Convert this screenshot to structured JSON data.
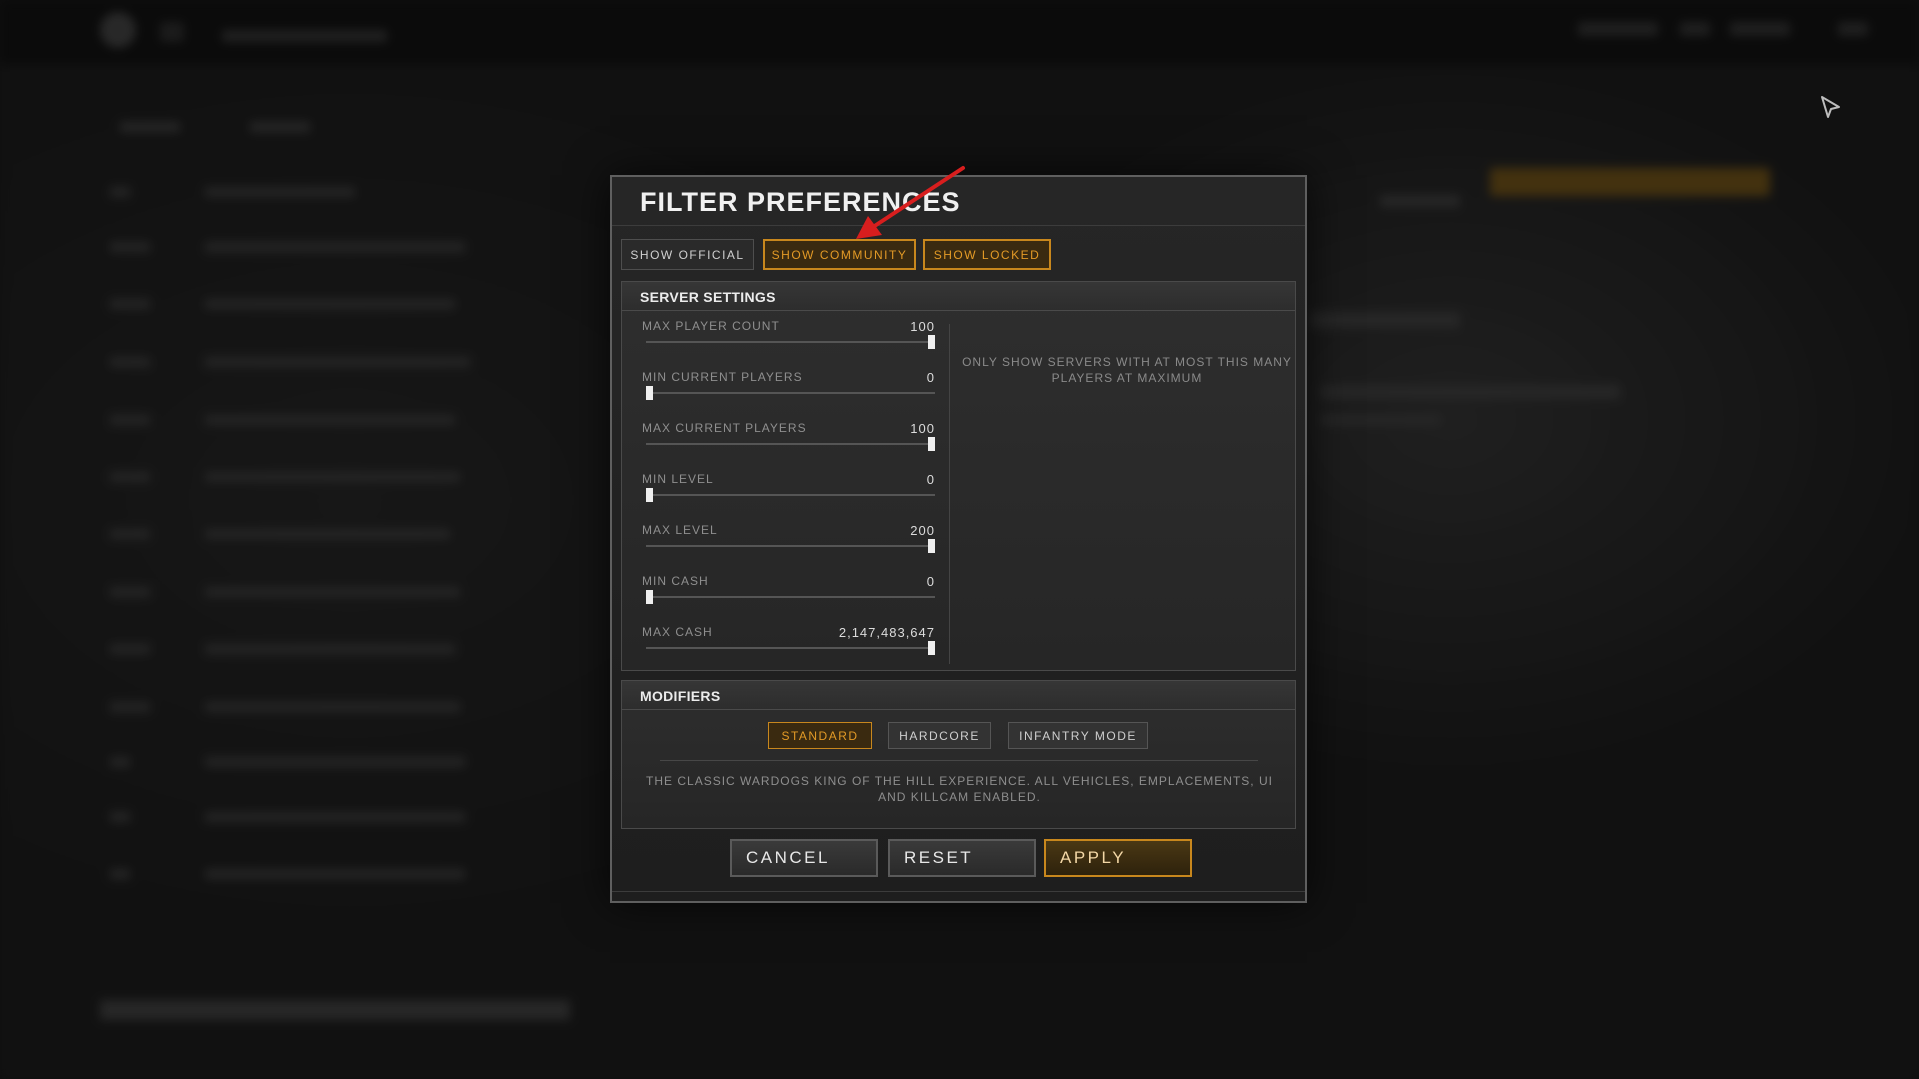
{
  "dialog": {
    "title": "FILTER PREFERENCES",
    "tabs": [
      {
        "label": "SHOW OFFICIAL",
        "active": false
      },
      {
        "label": "SHOW COMMUNITY",
        "active": true
      },
      {
        "label": "SHOW LOCKED",
        "active": true
      }
    ],
    "server_settings": {
      "heading": "SERVER SETTINGS",
      "sliders": [
        {
          "label": "MAX PLAYER COUNT",
          "value": "100",
          "fraction": 1
        },
        {
          "label": "MIN CURRENT PLAYERS",
          "value": "0",
          "fraction": 0
        },
        {
          "label": "MAX CURRENT PLAYERS",
          "value": "100",
          "fraction": 1
        },
        {
          "label": "MIN LEVEL",
          "value": "0",
          "fraction": 0
        },
        {
          "label": "MAX LEVEL",
          "value": "200",
          "fraction": 1
        },
        {
          "label": "MIN CASH",
          "value": "0",
          "fraction": 0
        },
        {
          "label": "MAX CASH",
          "value": "2,147,483,647",
          "fraction": 1
        }
      ],
      "hint": "ONLY SHOW SERVERS WITH AT MOST THIS MANY PLAYERS AT MAXIMUM"
    },
    "modifiers": {
      "heading": "MODIFIERS",
      "options": [
        {
          "label": "STANDARD",
          "active": true
        },
        {
          "label": "HARDCORE",
          "active": false
        },
        {
          "label": "INFANTRY MODE",
          "active": false
        }
      ],
      "description": "THE CLASSIC WARDOGS KING OF THE HILL EXPERIENCE. ALL VEHICLES, EMPLACEMENTS, UI AND KILLCAM ENABLED."
    },
    "actions": {
      "cancel": "CANCEL",
      "reset": "RESET",
      "apply": "APPLY"
    }
  },
  "colors": {
    "accent": "#c8871d",
    "accent_text": "#e39a26",
    "annotation_arrow": "#d81e1e"
  },
  "icons": {
    "annotation": "red-arrow-icon",
    "cursor": "mouse-cursor-icon"
  }
}
